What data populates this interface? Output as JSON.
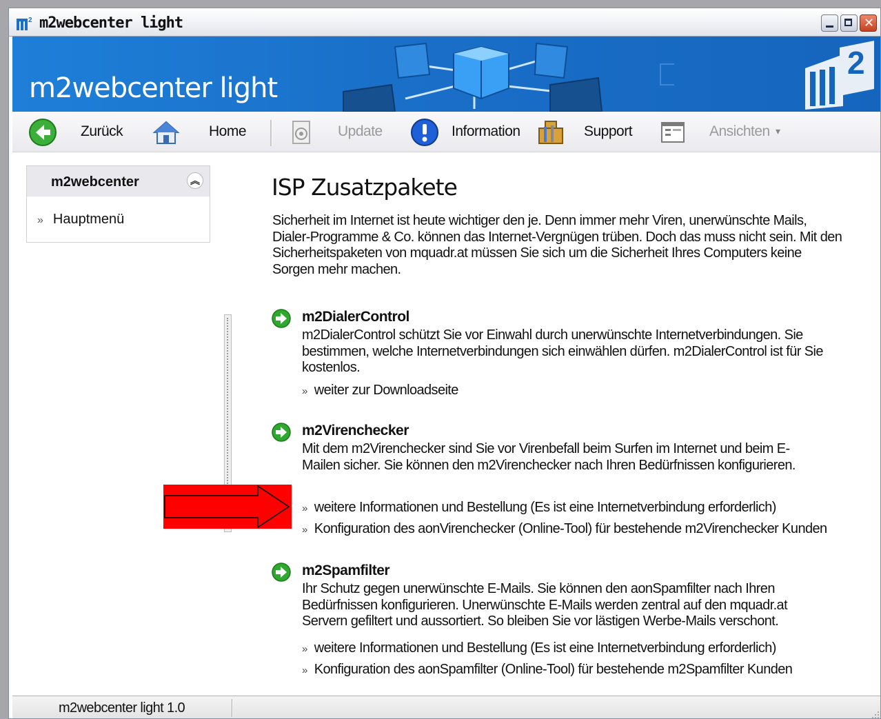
{
  "window": {
    "title": "m2webcenter light"
  },
  "banner": {
    "title": "m2webcenter light"
  },
  "toolbar": {
    "items": [
      {
        "label": "Zurück",
        "icon": "back-arrow-icon",
        "enabled": true
      },
      {
        "label": "Home",
        "icon": "home-icon",
        "enabled": true
      },
      {
        "label": "Update",
        "icon": "update-icon",
        "enabled": false
      },
      {
        "label": "Information",
        "icon": "info-icon",
        "enabled": true
      },
      {
        "label": "Support",
        "icon": "support-tools-icon",
        "enabled": true
      },
      {
        "label": "Ansichten",
        "icon": "view-window-icon",
        "enabled": false
      }
    ]
  },
  "sidebar": {
    "title": "m2webcenter",
    "items": [
      {
        "label": "Hauptmenü"
      }
    ]
  },
  "main": {
    "title": "ISP Zusatzpakete",
    "intro": "Sicherheit im Internet ist heute wichtiger den je. Denn immer mehr Viren, unerwünschte Mails, Dialer-Programme & Co. können das Internet-Vergnügen trüben. Doch das muss nicht sein. Mit den Sicherheitspaketen von mquadr.at müssen Sie sich um die Sicherheit Ihres Computers keine Sorgen mehr machen.",
    "sections": [
      {
        "title": "m2DialerControl",
        "description": "m2DialerControl schützt Sie vor Einwahl durch unerwünschte Internetverbindungen. Sie bestimmen, welche Internetverbindungen sich einwählen dürfen. m2DialerControl ist für Sie kostenlos.",
        "links": [
          "weiter zur Downloadseite"
        ]
      },
      {
        "title": "m2Virenchecker",
        "description": "Mit dem m2Virenchecker sind Sie vor Virenbefall beim Surfen im Internet und beim E-Mailen sicher. Sie können den m2Virenchecker nach Ihren Bedürfnissen konfigurieren.",
        "links": [
          "weitere Informationen und Bestellung (Es ist eine Internetverbindung erforderlich)",
          "Konfiguration des aonVirenchecker (Online-Tool) für bestehende m2Virenchecker Kunden"
        ]
      },
      {
        "title": "m2Spamfilter",
        "description": "Ihr Schutz gegen unerwünschte E-Mails. Sie können den aonSpamfilter nach Ihren Bedürfnissen konfigurieren. Unerwünschte E-Mails werden zentral auf den mquadr.at Servern gefiltert und aussortiert. So bleiben Sie vor lästigen Werbe-Mails verschont.",
        "links": [
          "weitere Informationen und Bestellung  (Es ist eine Internetverbindung erforderlich)",
          "Konfiguration des aonSpamfilter (Online-Tool) für bestehende m2Spamfilter Kunden"
        ]
      }
    ]
  },
  "statusbar": {
    "text": "m2webcenter light 1.0"
  },
  "colors": {
    "banner_blue": "#1a6fc8",
    "annotation_red": "#ff0000",
    "section_arrow_green": "#2fa82f"
  }
}
